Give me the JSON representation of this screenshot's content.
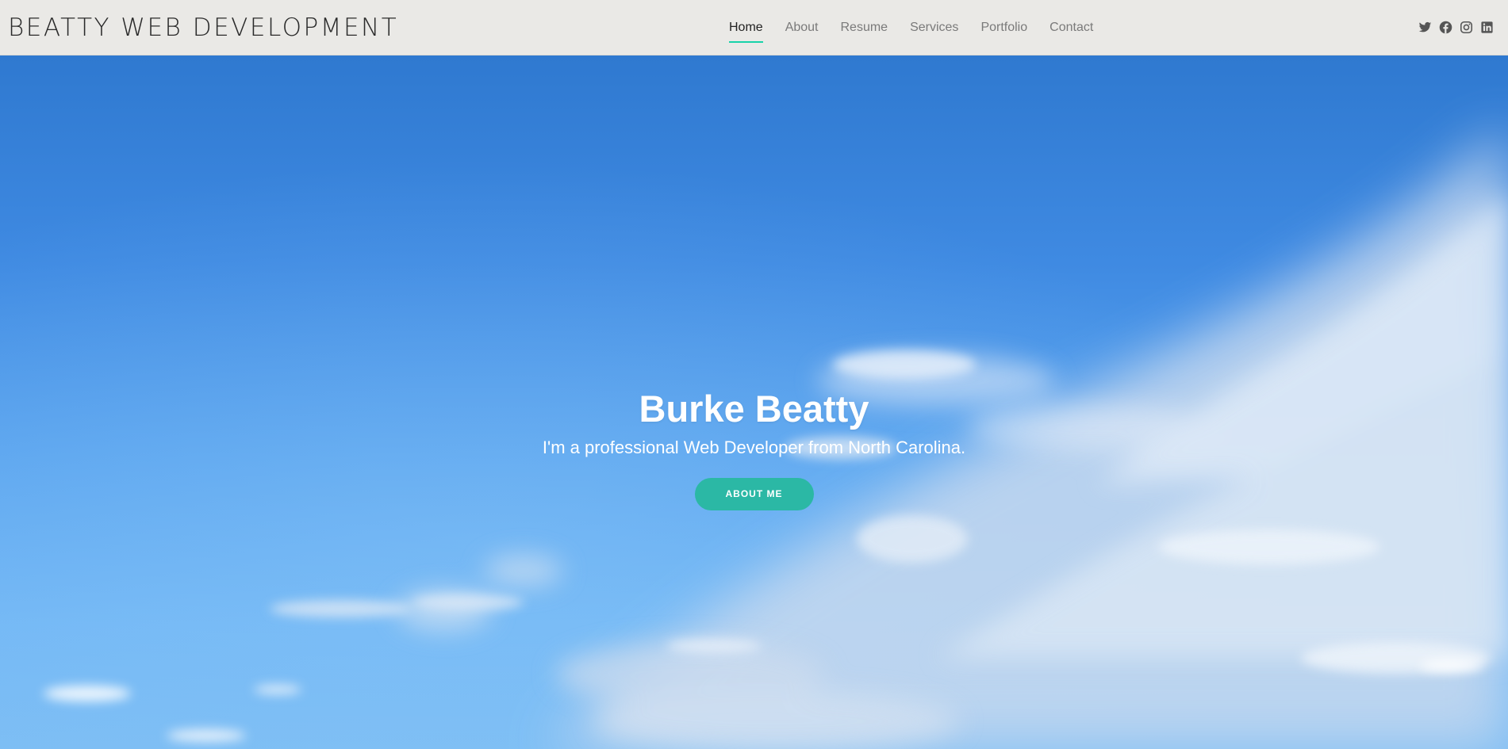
{
  "site": {
    "brand": "BEATTY WEB DEVELOPMENT"
  },
  "nav": {
    "items": [
      {
        "label": "Home",
        "active": true
      },
      {
        "label": "About"
      },
      {
        "label": "Resume"
      },
      {
        "label": "Services"
      },
      {
        "label": "Portfolio"
      },
      {
        "label": "Contact"
      }
    ],
    "accent_color": "#18d2a8"
  },
  "social": [
    {
      "icon": "twitter-icon"
    },
    {
      "icon": "facebook-icon"
    },
    {
      "icon": "instagram-icon"
    },
    {
      "icon": "linkedin-icon"
    }
  ],
  "hero": {
    "title": "Burke Beatty",
    "subtitle": "I'm a professional Web Developer from North Carolina.",
    "button_label": "ABOUT ME",
    "button_color": "#2bb8a5",
    "background": "blue sky with clouds"
  }
}
